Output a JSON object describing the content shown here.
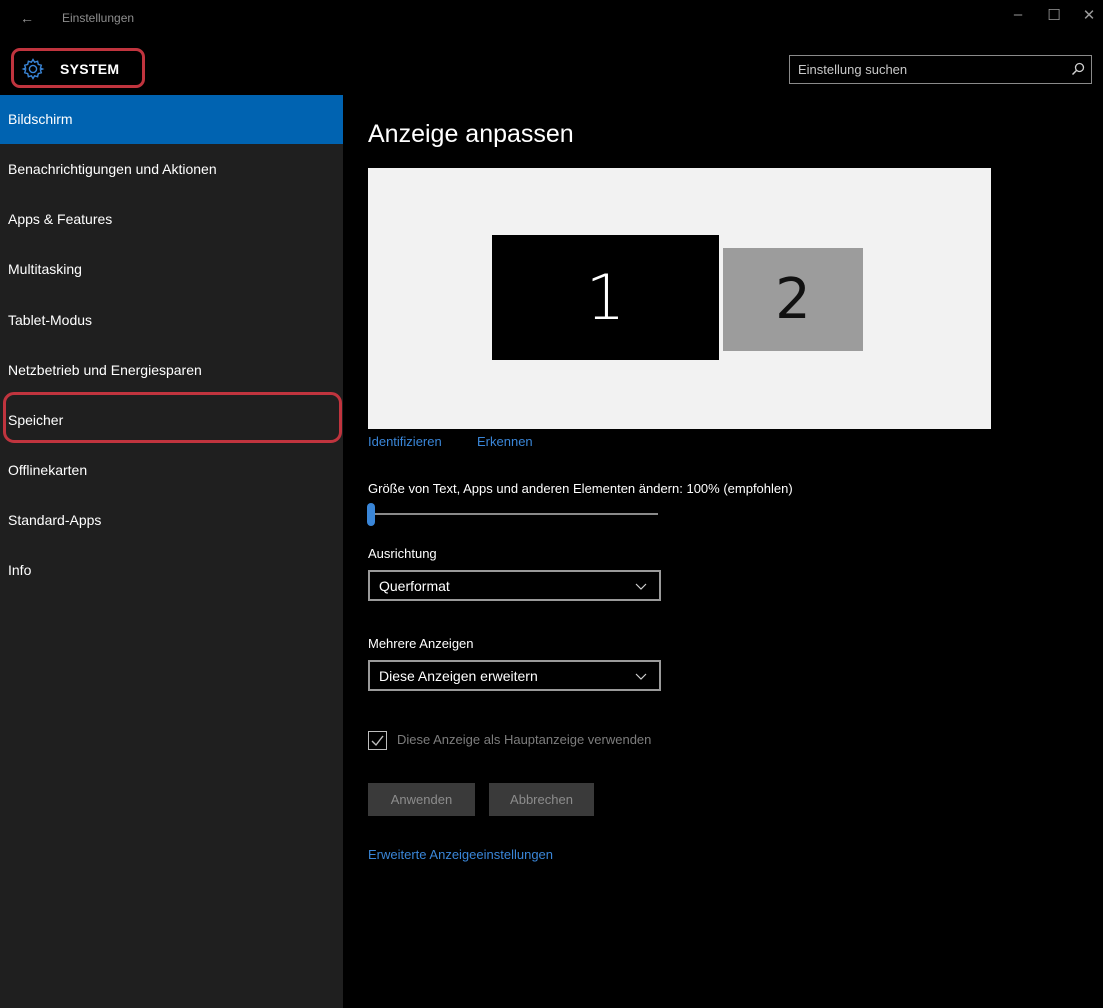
{
  "window": {
    "back": "←",
    "title": "Einstellungen",
    "controls": {
      "minimize": "–",
      "maximize": "☐",
      "close": "✕"
    }
  },
  "header": {
    "section": "SYSTEM",
    "search_placeholder": "Einstellung suchen"
  },
  "sidebar": {
    "items": [
      {
        "label": "Bildschirm",
        "active": true
      },
      {
        "label": "Benachrichtigungen und Aktionen"
      },
      {
        "label": "Apps & Features"
      },
      {
        "label": "Multitasking"
      },
      {
        "label": "Tablet-Modus"
      },
      {
        "label": "Netzbetrieb und Energiesparen"
      },
      {
        "label": "Speicher"
      },
      {
        "label": "Offlinekarten"
      },
      {
        "label": "Standard-Apps"
      },
      {
        "label": "Info"
      }
    ]
  },
  "main": {
    "title": "Anzeige anpassen",
    "monitors": [
      "1",
      "2"
    ],
    "links": {
      "identify": "Identifizieren",
      "detect": "Erkennen"
    },
    "scale_label": "Größe von Text, Apps und anderen Elementen ändern: 100% (empfohlen)",
    "scale_value": 0,
    "orientation_label": "Ausrichtung",
    "orientation_value": "Querformat",
    "multi_label": "Mehrere Anzeigen",
    "multi_value": "Diese Anzeigen erweitern",
    "primary_checkbox": "Diese Anzeige als Hauptanzeige verwenden",
    "primary_checked": true,
    "apply": "Anwenden",
    "cancel": "Abbrechen",
    "advanced": "Erweiterte Anzeigeeinstellungen"
  },
  "colors": {
    "accent": "#0063b1",
    "link": "#3a86d8",
    "highlight": "#c0343e"
  }
}
